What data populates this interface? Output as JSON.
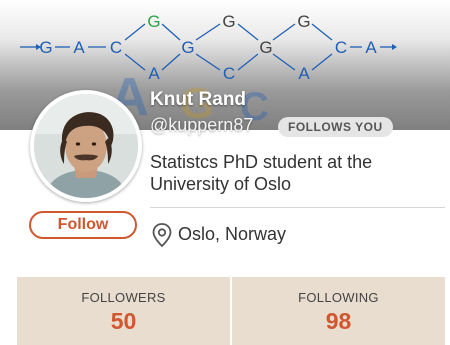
{
  "profile": {
    "name": "Knut Rand",
    "handle": "@kuppern87",
    "follows_you_badge": "FOLLOWS YOU",
    "bio": "Statistcs PhD student at the University of Oslo",
    "location": "Oslo, Norway",
    "follow_button": "Follow"
  },
  "banner": {
    "sequence_letters": [
      "G",
      "A",
      "C",
      "G",
      "A",
      "G",
      "G",
      "C",
      "G",
      "G",
      "A",
      "C",
      "A"
    ],
    "colors": {
      "G": "#2aa44a",
      "A": "#1f5fb5",
      "C": "#1f5fb5",
      "line": "#1f5fb5"
    }
  },
  "stats": {
    "followers_label": "FOLLOWERS",
    "followers_value": "50",
    "following_label": "FOLLOWING",
    "following_value": "98"
  },
  "colors": {
    "accent": "#d0572e",
    "stats_background": "#e9ddd0"
  }
}
